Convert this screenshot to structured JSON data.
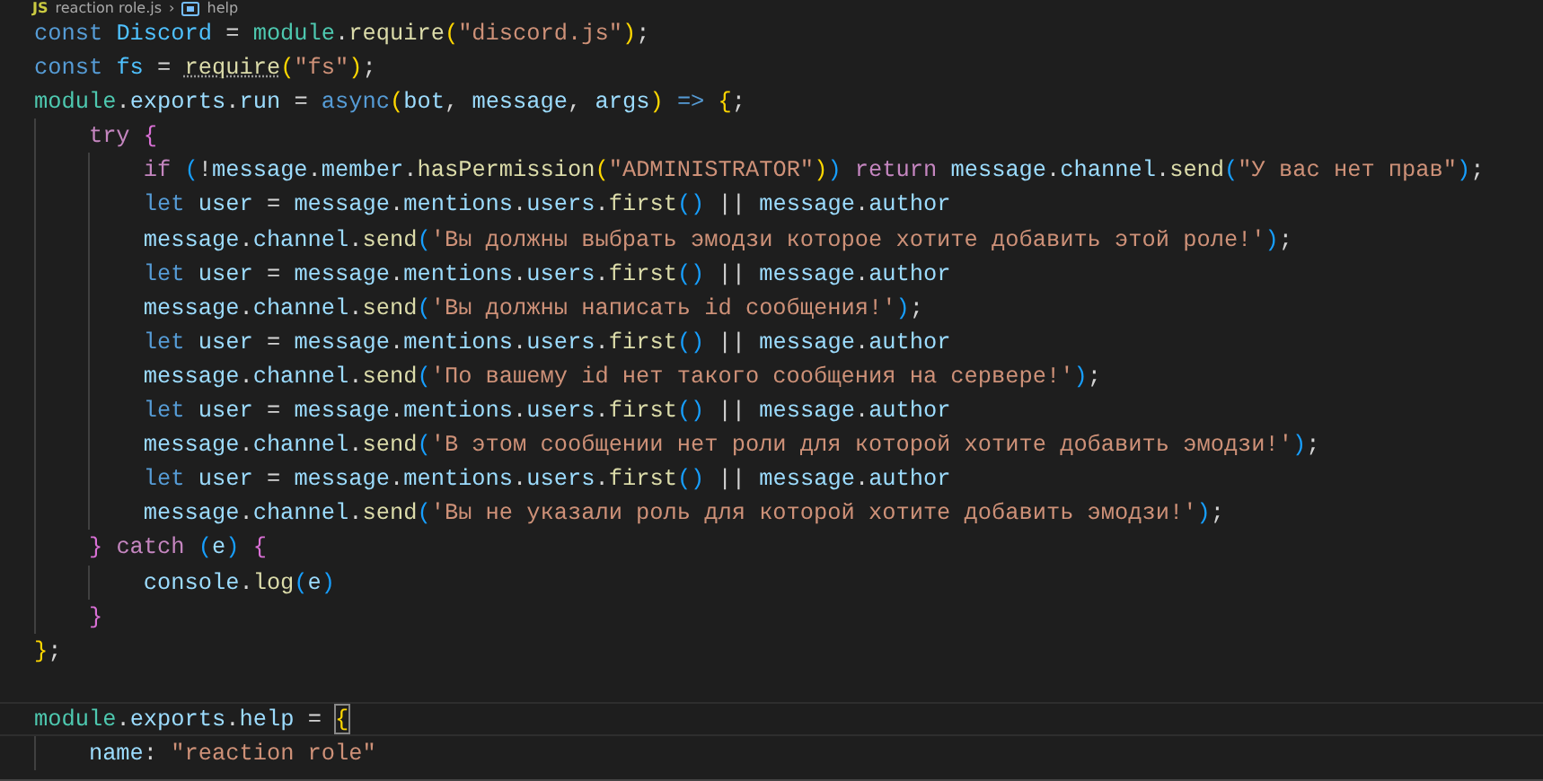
{
  "breadcrumb": {
    "file_icon": "JS",
    "file": "reaction role.js",
    "separator": "›",
    "symbol": "help"
  },
  "lines": [
    {
      "kind": "code",
      "current": false,
      "tokens": [
        {
          "kind": "kw",
          "text": "const "
        },
        {
          "kind": "const",
          "text": "Discord"
        },
        {
          "kind": "p",
          "text": " = "
        },
        {
          "kind": "cls",
          "text": "module"
        },
        {
          "kind": "p",
          "text": "."
        },
        {
          "kind": "fn",
          "text": "require"
        },
        {
          "kind": "b1",
          "text": "("
        },
        {
          "kind": "str",
          "text": "\"discord.js\""
        },
        {
          "kind": "b1",
          "text": ")"
        },
        {
          "kind": "p",
          "text": ";"
        }
      ]
    },
    {
      "kind": "code",
      "current": false,
      "tokens": [
        {
          "kind": "kw",
          "text": "const "
        },
        {
          "kind": "const",
          "text": "fs"
        },
        {
          "kind": "p",
          "text": " = "
        },
        {
          "kind": "hint",
          "text": "require"
        },
        {
          "kind": "b1",
          "text": "("
        },
        {
          "kind": "str",
          "text": "\"fs\""
        },
        {
          "kind": "b1",
          "text": ")"
        },
        {
          "kind": "p",
          "text": ";"
        }
      ]
    },
    {
      "kind": "code",
      "current": false,
      "tokens": [
        {
          "kind": "cls",
          "text": "module"
        },
        {
          "kind": "p",
          "text": "."
        },
        {
          "kind": "var",
          "text": "exports"
        },
        {
          "kind": "p",
          "text": "."
        },
        {
          "kind": "var",
          "text": "run"
        },
        {
          "kind": "p",
          "text": " = "
        },
        {
          "kind": "kw",
          "text": "async"
        },
        {
          "kind": "b1",
          "text": "("
        },
        {
          "kind": "var",
          "text": "bot"
        },
        {
          "kind": "p",
          "text": ", "
        },
        {
          "kind": "var",
          "text": "message"
        },
        {
          "kind": "p",
          "text": ", "
        },
        {
          "kind": "var",
          "text": "args"
        },
        {
          "kind": "b1",
          "text": ")"
        },
        {
          "kind": "kw",
          "text": " => "
        },
        {
          "kind": "b1",
          "text": "{"
        },
        {
          "kind": "p",
          "text": ";"
        }
      ]
    },
    {
      "kind": "code",
      "current": false,
      "guides": [
        {
          "kind": "line"
        }
      ],
      "tokens": [
        {
          "kind": "ctrl",
          "text": "try "
        },
        {
          "kind": "b2",
          "text": "{"
        }
      ]
    },
    {
      "kind": "code",
      "current": false,
      "guides": [
        {
          "kind": "line"
        },
        {
          "kind": "line"
        }
      ],
      "tokens": [
        {
          "kind": "ctrl",
          "text": "if "
        },
        {
          "kind": "b3",
          "text": "("
        },
        {
          "kind": "p",
          "text": "!"
        },
        {
          "kind": "var",
          "text": "message"
        },
        {
          "kind": "p",
          "text": "."
        },
        {
          "kind": "var",
          "text": "member"
        },
        {
          "kind": "p",
          "text": "."
        },
        {
          "kind": "fn",
          "text": "hasPermission"
        },
        {
          "kind": "b1",
          "text": "("
        },
        {
          "kind": "str",
          "text": "\"ADMINISTRATOR\""
        },
        {
          "kind": "b1",
          "text": ")"
        },
        {
          "kind": "b3",
          "text": ")"
        },
        {
          "kind": "ctrl",
          "text": " return "
        },
        {
          "kind": "var",
          "text": "message"
        },
        {
          "kind": "p",
          "text": "."
        },
        {
          "kind": "var",
          "text": "channel"
        },
        {
          "kind": "p",
          "text": "."
        },
        {
          "kind": "fn",
          "text": "send"
        },
        {
          "kind": "b3",
          "text": "("
        },
        {
          "kind": "str",
          "text": "\"У вас нет прав\""
        },
        {
          "kind": "b3",
          "text": ")"
        },
        {
          "kind": "p",
          "text": ";"
        }
      ]
    },
    {
      "kind": "code",
      "current": false,
      "guides": [
        {
          "kind": "line"
        },
        {
          "kind": "line"
        }
      ],
      "tokens": [
        {
          "kind": "kw",
          "text": "let "
        },
        {
          "kind": "var",
          "text": "user"
        },
        {
          "kind": "p",
          "text": " = "
        },
        {
          "kind": "var",
          "text": "message"
        },
        {
          "kind": "p",
          "text": "."
        },
        {
          "kind": "var",
          "text": "mentions"
        },
        {
          "kind": "p",
          "text": "."
        },
        {
          "kind": "var",
          "text": "users"
        },
        {
          "kind": "p",
          "text": "."
        },
        {
          "kind": "fn",
          "text": "first"
        },
        {
          "kind": "b3",
          "text": "()"
        },
        {
          "kind": "p",
          "text": " || "
        },
        {
          "kind": "var",
          "text": "message"
        },
        {
          "kind": "p",
          "text": "."
        },
        {
          "kind": "var",
          "text": "author"
        }
      ]
    },
    {
      "kind": "code",
      "current": false,
      "guides": [
        {
          "kind": "line"
        },
        {
          "kind": "line"
        }
      ],
      "tokens": [
        {
          "kind": "var",
          "text": "message"
        },
        {
          "kind": "p",
          "text": "."
        },
        {
          "kind": "var",
          "text": "channel"
        },
        {
          "kind": "p",
          "text": "."
        },
        {
          "kind": "fn",
          "text": "send"
        },
        {
          "kind": "b3",
          "text": "("
        },
        {
          "kind": "str",
          "text": "'Вы должны выбрать эмодзи которое хотите добавить этой роле!'"
        },
        {
          "kind": "b3",
          "text": ")"
        },
        {
          "kind": "p",
          "text": ";"
        }
      ]
    },
    {
      "kind": "code",
      "current": false,
      "guides": [
        {
          "kind": "line"
        },
        {
          "kind": "line"
        }
      ],
      "tokens": [
        {
          "kind": "kw",
          "text": "let "
        },
        {
          "kind": "var",
          "text": "user"
        },
        {
          "kind": "p",
          "text": " = "
        },
        {
          "kind": "var",
          "text": "message"
        },
        {
          "kind": "p",
          "text": "."
        },
        {
          "kind": "var",
          "text": "mentions"
        },
        {
          "kind": "p",
          "text": "."
        },
        {
          "kind": "var",
          "text": "users"
        },
        {
          "kind": "p",
          "text": "."
        },
        {
          "kind": "fn",
          "text": "first"
        },
        {
          "kind": "b3",
          "text": "()"
        },
        {
          "kind": "p",
          "text": " || "
        },
        {
          "kind": "var",
          "text": "message"
        },
        {
          "kind": "p",
          "text": "."
        },
        {
          "kind": "var",
          "text": "author"
        }
      ]
    },
    {
      "kind": "code",
      "current": false,
      "guides": [
        {
          "kind": "line"
        },
        {
          "kind": "line"
        }
      ],
      "tokens": [
        {
          "kind": "var",
          "text": "message"
        },
        {
          "kind": "p",
          "text": "."
        },
        {
          "kind": "var",
          "text": "channel"
        },
        {
          "kind": "p",
          "text": "."
        },
        {
          "kind": "fn",
          "text": "send"
        },
        {
          "kind": "b3",
          "text": "("
        },
        {
          "kind": "str",
          "text": "'Вы должны написать id сообщения!'"
        },
        {
          "kind": "b3",
          "text": ")"
        },
        {
          "kind": "p",
          "text": ";"
        }
      ]
    },
    {
      "kind": "code",
      "current": false,
      "guides": [
        {
          "kind": "line"
        },
        {
          "kind": "line"
        }
      ],
      "tokens": [
        {
          "kind": "kw",
          "text": "let "
        },
        {
          "kind": "var",
          "text": "user"
        },
        {
          "kind": "p",
          "text": " = "
        },
        {
          "kind": "var",
          "text": "message"
        },
        {
          "kind": "p",
          "text": "."
        },
        {
          "kind": "var",
          "text": "mentions"
        },
        {
          "kind": "p",
          "text": "."
        },
        {
          "kind": "var",
          "text": "users"
        },
        {
          "kind": "p",
          "text": "."
        },
        {
          "kind": "fn",
          "text": "first"
        },
        {
          "kind": "b3",
          "text": "()"
        },
        {
          "kind": "p",
          "text": " || "
        },
        {
          "kind": "var",
          "text": "message"
        },
        {
          "kind": "p",
          "text": "."
        },
        {
          "kind": "var",
          "text": "author"
        }
      ]
    },
    {
      "kind": "code",
      "current": false,
      "guides": [
        {
          "kind": "line"
        },
        {
          "kind": "line"
        }
      ],
      "tokens": [
        {
          "kind": "var",
          "text": "message"
        },
        {
          "kind": "p",
          "text": "."
        },
        {
          "kind": "var",
          "text": "channel"
        },
        {
          "kind": "p",
          "text": "."
        },
        {
          "kind": "fn",
          "text": "send"
        },
        {
          "kind": "b3",
          "text": "("
        },
        {
          "kind": "str",
          "text": "'По вашему id нет такого сообщения на сервере!'"
        },
        {
          "kind": "b3",
          "text": ")"
        },
        {
          "kind": "p",
          "text": ";"
        }
      ]
    },
    {
      "kind": "code",
      "current": false,
      "guides": [
        {
          "kind": "line"
        },
        {
          "kind": "line"
        }
      ],
      "tokens": [
        {
          "kind": "kw",
          "text": "let "
        },
        {
          "kind": "var",
          "text": "user"
        },
        {
          "kind": "p",
          "text": " = "
        },
        {
          "kind": "var",
          "text": "message"
        },
        {
          "kind": "p",
          "text": "."
        },
        {
          "kind": "var",
          "text": "mentions"
        },
        {
          "kind": "p",
          "text": "."
        },
        {
          "kind": "var",
          "text": "users"
        },
        {
          "kind": "p",
          "text": "."
        },
        {
          "kind": "fn",
          "text": "first"
        },
        {
          "kind": "b3",
          "text": "()"
        },
        {
          "kind": "p",
          "text": " || "
        },
        {
          "kind": "var",
          "text": "message"
        },
        {
          "kind": "p",
          "text": "."
        },
        {
          "kind": "var",
          "text": "author"
        }
      ]
    },
    {
      "kind": "code",
      "current": false,
      "guides": [
        {
          "kind": "line"
        },
        {
          "kind": "line"
        }
      ],
      "tokens": [
        {
          "kind": "var",
          "text": "message"
        },
        {
          "kind": "p",
          "text": "."
        },
        {
          "kind": "var",
          "text": "channel"
        },
        {
          "kind": "p",
          "text": "."
        },
        {
          "kind": "fn",
          "text": "send"
        },
        {
          "kind": "b3",
          "text": "("
        },
        {
          "kind": "str",
          "text": "'В этом сообщении нет роли для которой хотите добавить эмодзи!'"
        },
        {
          "kind": "b3",
          "text": ")"
        },
        {
          "kind": "p",
          "text": ";"
        }
      ]
    },
    {
      "kind": "code",
      "current": false,
      "guides": [
        {
          "kind": "line"
        },
        {
          "kind": "line"
        }
      ],
      "tokens": [
        {
          "kind": "kw",
          "text": "let "
        },
        {
          "kind": "var",
          "text": "user"
        },
        {
          "kind": "p",
          "text": " = "
        },
        {
          "kind": "var",
          "text": "message"
        },
        {
          "kind": "p",
          "text": "."
        },
        {
          "kind": "var",
          "text": "mentions"
        },
        {
          "kind": "p",
          "text": "."
        },
        {
          "kind": "var",
          "text": "users"
        },
        {
          "kind": "p",
          "text": "."
        },
        {
          "kind": "fn",
          "text": "first"
        },
        {
          "kind": "b3",
          "text": "()"
        },
        {
          "kind": "p",
          "text": " || "
        },
        {
          "kind": "var",
          "text": "message"
        },
        {
          "kind": "p",
          "text": "."
        },
        {
          "kind": "var",
          "text": "author"
        }
      ]
    },
    {
      "kind": "code",
      "current": false,
      "guides": [
        {
          "kind": "line"
        },
        {
          "kind": "line"
        }
      ],
      "tokens": [
        {
          "kind": "var",
          "text": "message"
        },
        {
          "kind": "p",
          "text": "."
        },
        {
          "kind": "var",
          "text": "channel"
        },
        {
          "kind": "p",
          "text": "."
        },
        {
          "kind": "fn",
          "text": "send"
        },
        {
          "kind": "b3",
          "text": "("
        },
        {
          "kind": "str",
          "text": "'Вы не указали роль для которой хотите добавить эмодзи!'"
        },
        {
          "kind": "b3",
          "text": ")"
        },
        {
          "kind": "p",
          "text": ";"
        }
      ]
    },
    {
      "kind": "code",
      "current": false,
      "guides": [
        {
          "kind": "line"
        }
      ],
      "tokens": [
        {
          "kind": "b2",
          "text": "}"
        },
        {
          "kind": "ctrl",
          "text": " catch "
        },
        {
          "kind": "b3",
          "text": "("
        },
        {
          "kind": "var",
          "text": "e"
        },
        {
          "kind": "b3",
          "text": ")"
        },
        {
          "kind": "b2",
          "text": " {"
        }
      ]
    },
    {
      "kind": "code",
      "current": false,
      "guides": [
        {
          "kind": "line"
        },
        {
          "kind": "line"
        }
      ],
      "tokens": [
        {
          "kind": "var",
          "text": "console"
        },
        {
          "kind": "p",
          "text": "."
        },
        {
          "kind": "fn",
          "text": "log"
        },
        {
          "kind": "b3",
          "text": "("
        },
        {
          "kind": "var",
          "text": "e"
        },
        {
          "kind": "b3",
          "text": ")"
        }
      ]
    },
    {
      "kind": "code",
      "current": false,
      "guides": [
        {
          "kind": "line"
        }
      ],
      "tokens": [
        {
          "kind": "b2",
          "text": "}"
        }
      ]
    },
    {
      "kind": "code",
      "current": false,
      "tokens": [
        {
          "kind": "b1",
          "text": "}"
        },
        {
          "kind": "p",
          "text": ";"
        }
      ]
    },
    {
      "kind": "blank",
      "current": false
    },
    {
      "kind": "code",
      "current": true,
      "tokens": [
        {
          "kind": "cls",
          "text": "module"
        },
        {
          "kind": "p",
          "text": "."
        },
        {
          "kind": "var",
          "text": "exports"
        },
        {
          "kind": "p",
          "text": "."
        },
        {
          "kind": "var",
          "text": "help"
        },
        {
          "kind": "p",
          "text": " = "
        },
        {
          "kind": "match",
          "text": "{"
        }
      ]
    },
    {
      "kind": "code",
      "current": false,
      "guides": [
        {
          "kind": "line"
        }
      ],
      "tokens": [
        {
          "kind": "var",
          "text": "name"
        },
        {
          "kind": "p",
          "text": ": "
        },
        {
          "kind": "str",
          "text": "\"reaction role\""
        }
      ]
    }
  ]
}
